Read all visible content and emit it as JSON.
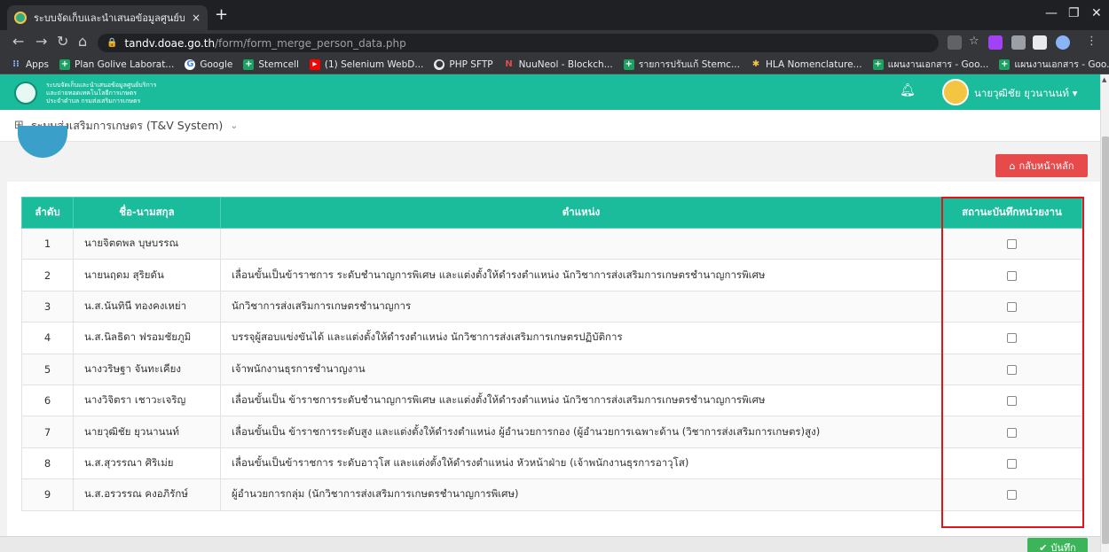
{
  "browser": {
    "tab_title": "ระบบจัดเก็บและนำเสนอข้อมูลศูนย์บริการ",
    "tab_close": "×",
    "new_tab": "+",
    "url_host": "tandv.doae.go.th",
    "url_path": "/form/form_merge_person_data.php",
    "bookmarks": [
      {
        "icon": "apps-icon",
        "label": "Apps"
      },
      {
        "icon": "plus-icon",
        "label": "Plan Golive Laborat..."
      },
      {
        "icon": "google-icon",
        "label": "Google"
      },
      {
        "icon": "plus-icon",
        "label": "Stemcell"
      },
      {
        "icon": "youtube-icon",
        "label": "(1) Selenium WebD..."
      },
      {
        "icon": "github-icon",
        "label": "PHP SFTP"
      },
      {
        "icon": "n-icon",
        "label": "NuuNeol - Blockch..."
      },
      {
        "icon": "plus-icon",
        "label": "รายการปรับแก้ Stemc..."
      },
      {
        "icon": "hla-icon",
        "label": "HLA Nomenclature..."
      },
      {
        "icon": "plus-icon",
        "label": "แผนงานเอกสาร - Goo..."
      },
      {
        "icon": "plus-icon",
        "label": "แผนงานเอกสาร - Goo..."
      }
    ],
    "bookmarks_more": "»"
  },
  "header": {
    "org_line1": "ระบบจัดเก็บและนำเสนอข้อมูลศูนย์บริการ",
    "org_line2": "และถ่ายทอดเทคโนโลยีการเกษตร",
    "org_line3": "ประจำตำบล กรมส่งเสริมการเกษตร",
    "user_name": "นายวุฒิชัย ยุวนานนท์ ▾"
  },
  "sysbar": {
    "system_name": "ระบบส่งเสริมการเกษตร (T&V System)"
  },
  "actions": {
    "back_label": "กลับหน้าหลัก",
    "save_label": "บันทึก"
  },
  "table": {
    "headers": [
      "ลำดับ",
      "ชื่อ-นามสกุล",
      "ตำแหน่ง",
      "สถานะบันทึกหน่วยงาน"
    ],
    "rows": [
      {
        "no": "1",
        "name": "นายจิตตพล บุษบรรณ",
        "position": ""
      },
      {
        "no": "2",
        "name": "นายนฤดม สุริยดัน",
        "position": "เลื่อนขั้นเป็นข้าราชการ ระดับชำนาญการพิเศษ และแต่งตั้งให้ดำรงตำแหน่ง นักวิชาการส่งเสริมการเกษตรชำนาญการพิเศษ"
      },
      {
        "no": "3",
        "name": "น.ส.นันทินี ทองคงเหย่า",
        "position": "นักวิชาการส่งเสริมการเกษตรชำนาญการ"
      },
      {
        "no": "4",
        "name": "น.ส.นิลธิดา ฟรอมชัยภูมิ",
        "position": "บรรจุผู้สอบแข่งขันได้ และแต่งตั้งให้ดำรงตำแหน่ง นักวิชาการส่งเสริมการเกษตรปฏิบัติการ"
      },
      {
        "no": "5",
        "name": "นางวริษฐา จันทะเคียง",
        "position": "เจ้าพนักงานธุรการชำนาญงาน"
      },
      {
        "no": "6",
        "name": "นางวิจิตรา เชาวะเจริญ",
        "position": "เลื่อนขั้นเป็น ข้าราชการระดับชำนาญการพิเศษ และแต่งตั้งให้ดำรงตำแหน่ง นักวิชาการส่งเสริมการเกษตรชำนาญการพิเศษ"
      },
      {
        "no": "7",
        "name": "นายวุฒิชัย ยุวนานนท์",
        "position": "เลื่อนขั้นเป็น ข้าราชการระดับสูง และแต่งตั้งให้ดำรงตำแหน่ง ผู้อำนวยการกอง (ผู้อำนวยการเฉพาะด้าน (วิชาการส่งเสริมการเกษตร)สูง)"
      },
      {
        "no": "8",
        "name": "น.ส.สุวรรณา ศิริเม่ย",
        "position": "เลื่อนขั้นเป็นข้าราชการ ระดับอาวุโส และแต่งตั้งให้ดำรงตำแหน่ง หัวหน้าฝ่าย (เจ้าพนักงานธุรการอาวุโส)"
      },
      {
        "no": "9",
        "name": "น.ส.อรวรรณ คงอภิรักษ์",
        "position": "ผู้อำนวยการกลุ่ม (นักวิชาการส่งเสริมการเกษตรชำนาญการพิเศษ)"
      }
    ]
  },
  "colors": {
    "accent": "#1abc9c",
    "danger": "#e64a4a",
    "success": "#3cb55a",
    "highlight": "#e0151b"
  }
}
